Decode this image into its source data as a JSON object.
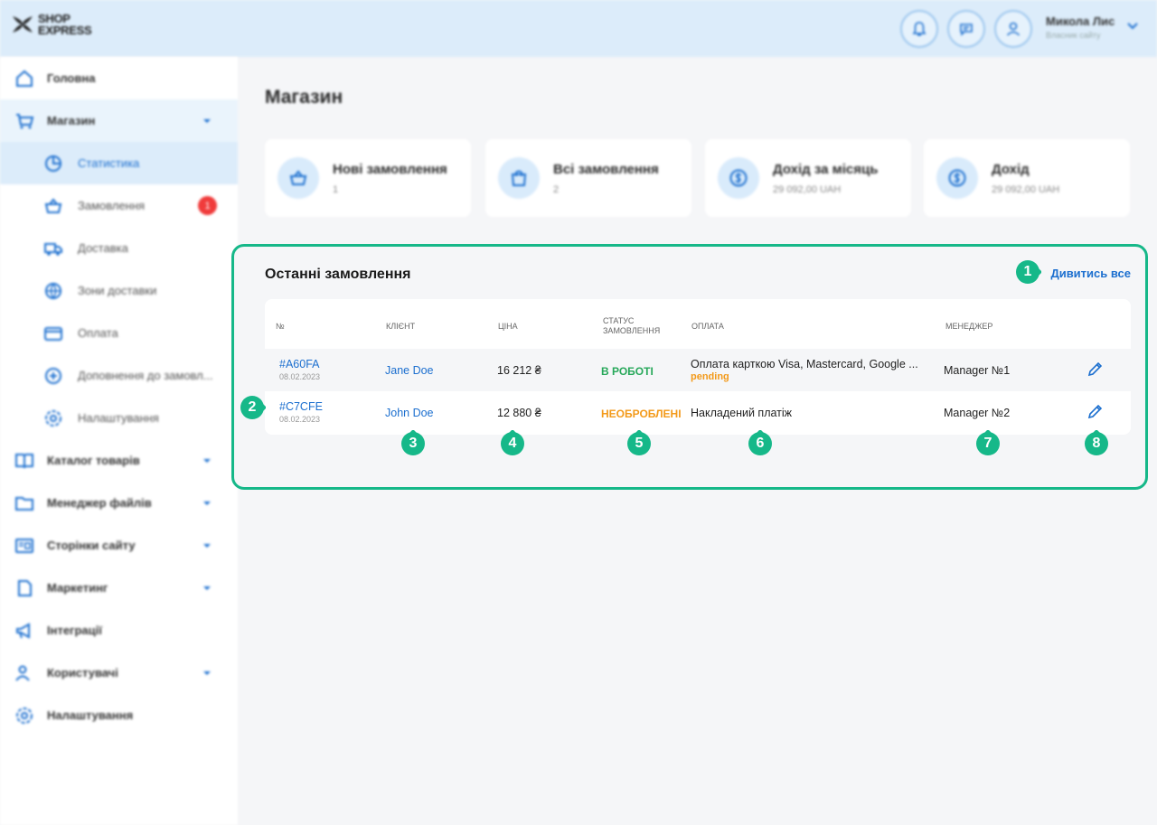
{
  "brand": {
    "line1": "SHOP",
    "line2": "EXPRESS"
  },
  "user": {
    "name": "Микола Лис",
    "role": "Власник сайту"
  },
  "header_icons": [
    "bell-icon",
    "chat-icon",
    "user-icon"
  ],
  "sidebar": {
    "items": [
      {
        "label": "Головна",
        "icon": "home-icon"
      },
      {
        "label": "Магазин",
        "icon": "cart-icon"
      },
      {
        "label": "Статистика",
        "icon": "pie-chart-icon"
      },
      {
        "label": "Замовлення",
        "icon": "basket-icon",
        "badge": "1"
      },
      {
        "label": "Доставка",
        "icon": "truck-icon"
      },
      {
        "label": "Зони доставки",
        "icon": "globe-icon"
      },
      {
        "label": "Оплата",
        "icon": "card-icon"
      },
      {
        "label": "Доповнення до замовл...",
        "icon": "plus-circle-icon"
      },
      {
        "label": "Налаштування",
        "icon": "gear-icon"
      },
      {
        "label": "Каталог товарів",
        "icon": "book-icon"
      },
      {
        "label": "Менеджер файлів",
        "icon": "folder-icon"
      },
      {
        "label": "Сторінки сайту",
        "icon": "pages-icon"
      },
      {
        "label": "Маркетинг",
        "icon": "tag-icon"
      },
      {
        "label": "Інтеграції",
        "icon": "megaphone-icon"
      },
      {
        "label": "Користувачі",
        "icon": "users-icon"
      },
      {
        "label": "Налаштування",
        "icon": "gear-icon"
      }
    ]
  },
  "page": {
    "title": "Магазин"
  },
  "stats": [
    {
      "title": "Нові замовлення",
      "value": "1"
    },
    {
      "title": "Всі замовлення",
      "value": "2"
    },
    {
      "title": "Дохід за місяць",
      "value": "29 092,00 UAH"
    },
    {
      "title": "Дохід",
      "value": "29 092,00 UAH"
    }
  ],
  "recent": {
    "title": "Останні замовлення",
    "view_all": "Дивитись все",
    "columns": [
      "№",
      "Клієнт",
      "Ціна",
      "Статус замовлення",
      "Оплата",
      "Менеджер"
    ],
    "rows": [
      {
        "id": "#A60FA",
        "date": "08.02.2023",
        "client": "Jane Doe",
        "price": "16 212 ₴",
        "status": "В РОБОТІ",
        "payment": "Оплата карткою Visa, Mastercard, Google ...",
        "payment_status": "pending",
        "manager": "Manager №1"
      },
      {
        "id": "#C7CFE",
        "date": "08.02.2023",
        "client": "John Doe",
        "price": "12 880 ₴",
        "status": "НЕОБРОБЛЕНІ",
        "payment": "Накладений платіж",
        "payment_status": "",
        "manager": "Manager №2"
      }
    ]
  },
  "markers": [
    "1",
    "2",
    "3",
    "4",
    "5",
    "6",
    "7",
    "8"
  ],
  "colors": {
    "accent": "#1c6fcf",
    "highlight": "#16b889",
    "status_work": "#27a85a",
    "status_new": "#f39a1a",
    "badge": "#f03b3b"
  }
}
